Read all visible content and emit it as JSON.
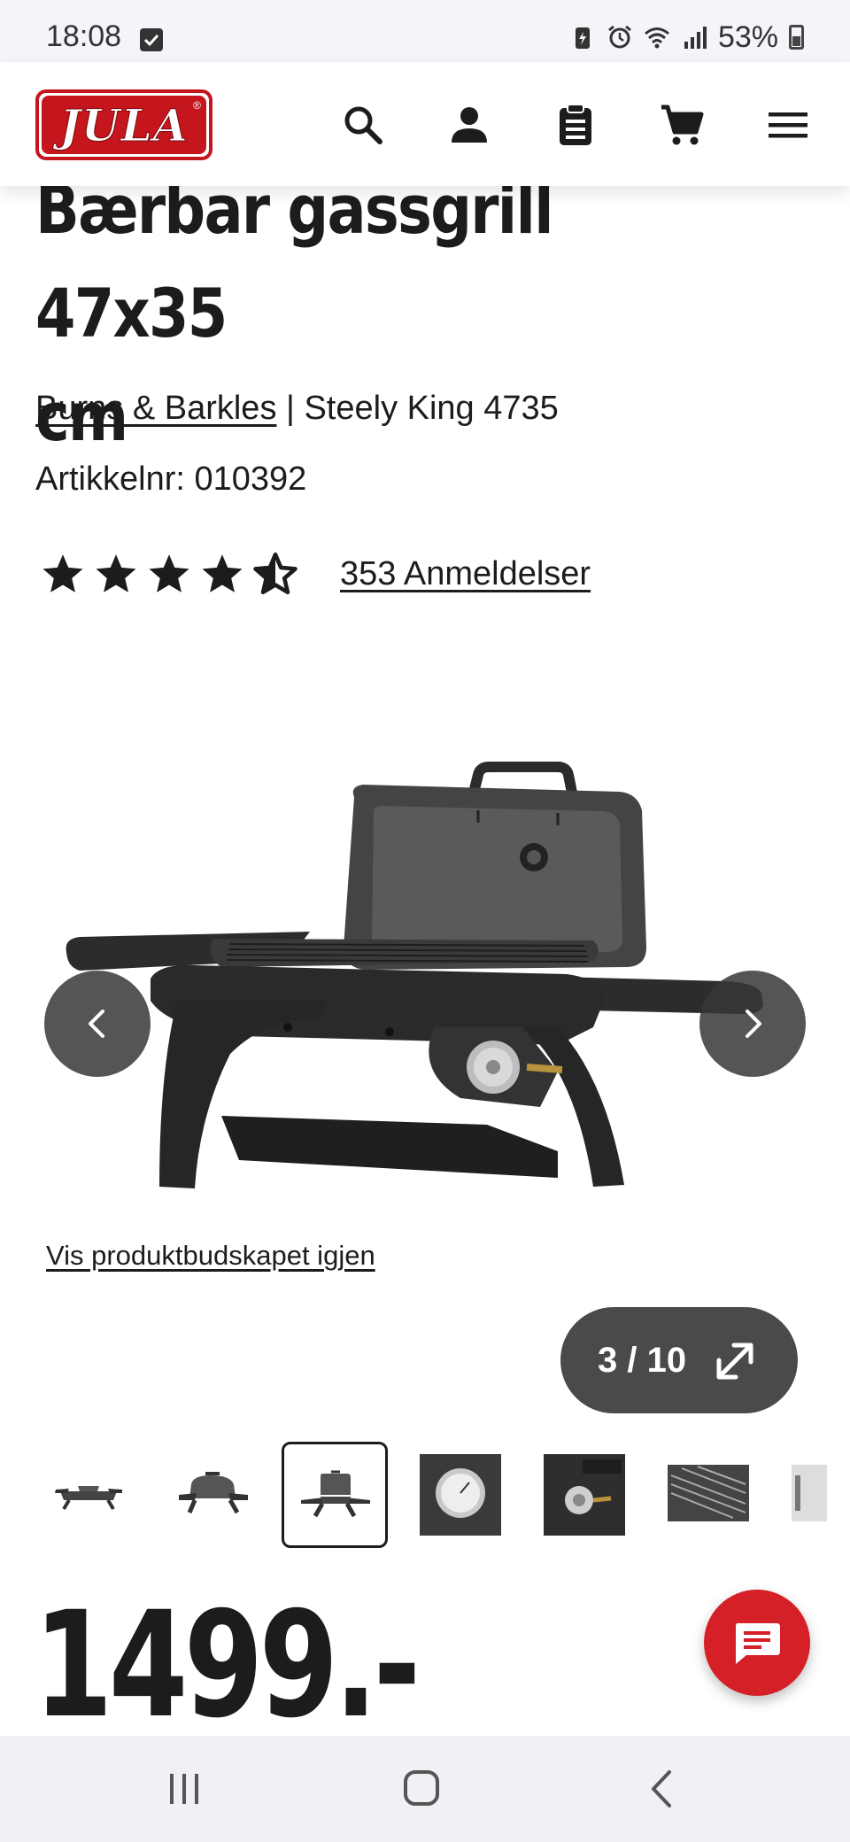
{
  "status_bar": {
    "time": "18:08",
    "battery": "53%",
    "icons": [
      "checkbox-notification-icon",
      "battery-saver-icon",
      "alarm-icon",
      "wifi-icon",
      "signal-icon",
      "battery-icon"
    ]
  },
  "header": {
    "logo_text": "JULA",
    "logo_reg": "®",
    "icons": [
      "search-icon",
      "account-icon",
      "shopping-list-icon",
      "cart-icon",
      "menu-icon"
    ],
    "brand_color": "#c4161c"
  },
  "product": {
    "title_line1": "Bærbar gassgrill 47x35",
    "title_line2": "cm",
    "brand": "Burns & Barkles",
    "separator": " | ",
    "model": "Steely King 4735",
    "sku_label": "Artikkelnr: 010392",
    "rating_value": 4.5,
    "rating_max": 5,
    "reviews_label": "353 Anmeldelser"
  },
  "gallery": {
    "replay_link": "Vis produktbudskapet igjen",
    "counter": "3 / 10",
    "current_index": 3,
    "total": 10,
    "thumbnails": [
      "grill-side-thumb",
      "grill-closed-thumb",
      "grill-open-thumb",
      "thermometer-thumb",
      "control-knob-thumb",
      "grate-closeup-thumb",
      "more-thumb"
    ],
    "selected_thumbnail": 3
  },
  "price": {
    "value": "1499.-"
  },
  "chat": {
    "icon": "chat-icon",
    "color": "#d42026"
  },
  "android_nav": {
    "icons": [
      "recents-icon",
      "home-icon",
      "back-icon"
    ]
  }
}
